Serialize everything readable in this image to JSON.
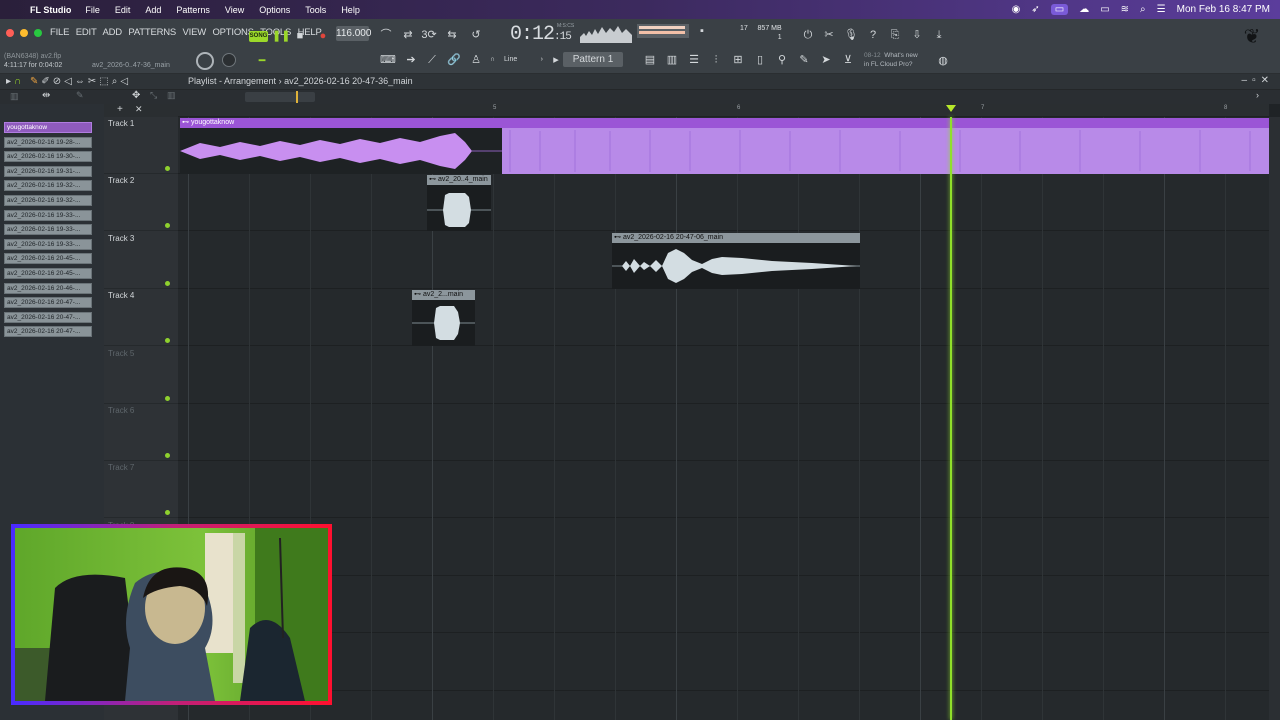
{
  "macos": {
    "app_name": "FL Studio",
    "menus": [
      "File",
      "Edit",
      "Add",
      "Patterns",
      "View",
      "Options",
      "Tools",
      "Help"
    ],
    "clock": "Mon Feb 16  8:47 PM"
  },
  "toolbar": {
    "fl_menus": [
      "FILE",
      "EDIT",
      "ADD",
      "PATTERNS",
      "VIEW",
      "OPTIONS",
      "TOOLS",
      "HELP"
    ],
    "mode_label": "SONG",
    "tempo": "116.000",
    "time_main": "0:12",
    "time_sub": ":15",
    "time_unit": "M:S:CS",
    "cpu_value": "17",
    "ram_value": "857 MB",
    "poly_value": "1",
    "snap_label": "Line",
    "pattern_label": "Pattern 1",
    "news_date": "08-12",
    "news_line1": "What's new",
    "news_line2": "in FL Cloud Pro?",
    "project_file": "(BAN6348) av2.flp",
    "hint_time": "4:11:17 for 0:04:02",
    "hint_name": "av2_2026-0..47-36_main"
  },
  "playlist": {
    "title": "Playlist - Arrangement",
    "breadcrumb_sep": "›",
    "arrangement": "av2_2026-02-16 20-47-36_main",
    "ruler_marks": [
      "5",
      "6",
      "7",
      "8"
    ],
    "tracks": [
      "Track 1",
      "Track 2",
      "Track 3",
      "Track 4",
      "Track 5",
      "Track 6",
      "Track 7",
      "Track 8"
    ]
  },
  "picker": {
    "items": [
      {
        "label": "yougottaknow",
        "selected": true
      },
      {
        "label": "av2_2026-02-16 19-28-...",
        "selected": false
      },
      {
        "label": "av2_2026-02-16 19-30-...",
        "selected": false
      },
      {
        "label": "av2_2026-02-16 19-31-...",
        "selected": false
      },
      {
        "label": "av2_2026-02-16 19-32-...",
        "selected": false
      },
      {
        "label": "av2_2026-02-16 19-32-...",
        "selected": false
      },
      {
        "label": "av2_2026-02-16 19-33-...",
        "selected": false
      },
      {
        "label": "av2_2026-02-16 19-33-...",
        "selected": false
      },
      {
        "label": "av2_2026-02-16 19-33-...",
        "selected": false
      },
      {
        "label": "av2_2026-02-16 20-45-...",
        "selected": false
      },
      {
        "label": "av2_2026-02-16 20-45-...",
        "selected": false
      },
      {
        "label": "av2_2026-02-16 20-46-...",
        "selected": false
      },
      {
        "label": "av2_2026-02-16 20-47-...",
        "selected": false
      },
      {
        "label": "av2_2026-02-16 20-47-...",
        "selected": false
      },
      {
        "label": "av2_2026-02-16 20-47-...",
        "selected": false
      }
    ]
  },
  "clips": {
    "c1": "⊷ yougottaknow",
    "c2": "⊷ av2_20..4_main",
    "c3": "⊷ av2_2026-02-16 20-47-06_main",
    "c4": "⊷ av2_2...main"
  },
  "colors": {
    "accent_purple": "#9b55d6",
    "playhead_green": "#8fe02a",
    "clip_grey": "#8c969c"
  }
}
